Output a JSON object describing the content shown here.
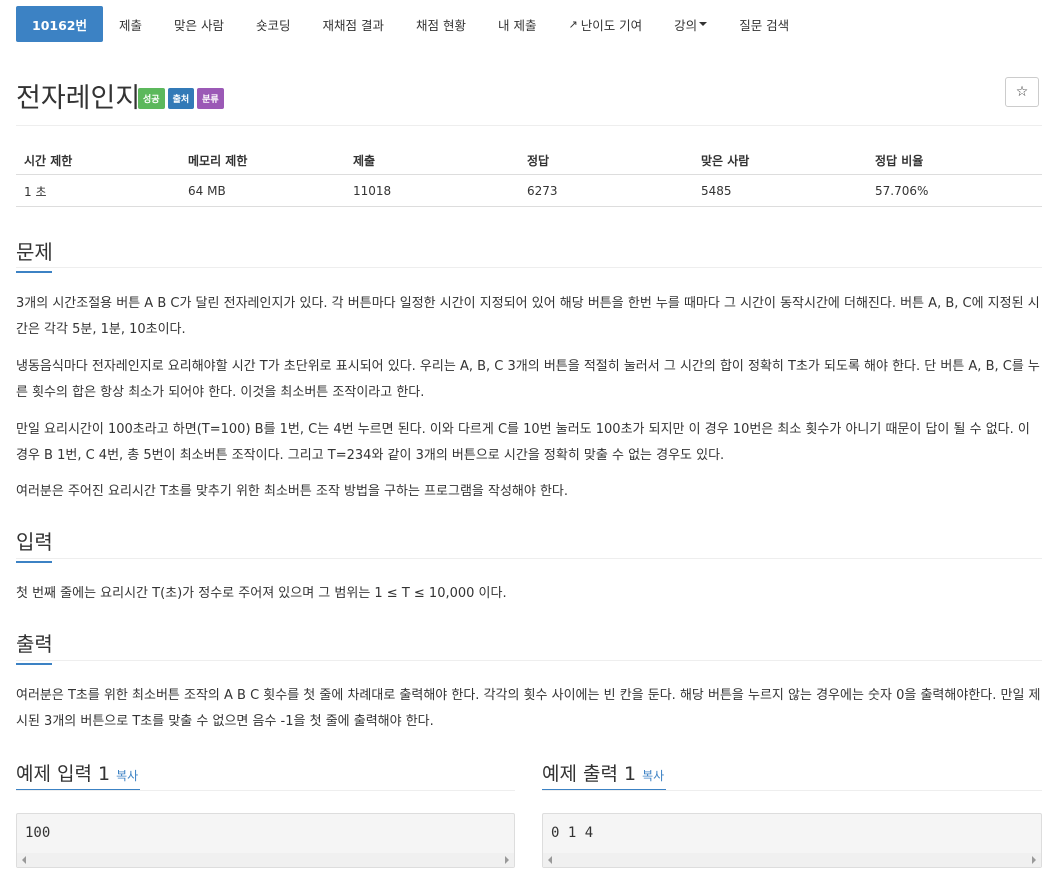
{
  "nav": {
    "tabs": [
      {
        "label": "10162번"
      },
      {
        "label": "제출"
      },
      {
        "label": "맞은 사람"
      },
      {
        "label": "숏코딩"
      },
      {
        "label": "재채점 결과"
      },
      {
        "label": "채점 현황"
      },
      {
        "label": "내 제출"
      },
      {
        "label": "난이도 기여"
      },
      {
        "label": "강의"
      },
      {
        "label": "질문 검색"
      }
    ],
    "active_tab": "10162번"
  },
  "problem": {
    "title": "전자레인지",
    "labels": [
      {
        "text": "성공",
        "color": "#5cb85c"
      },
      {
        "text": "출처",
        "color": "#337ab7"
      },
      {
        "text": "분류",
        "color": "#9b59b6"
      }
    ],
    "star_icon": "star-icon"
  },
  "info_table": {
    "headers": [
      "시간 제한",
      "메모리 제한",
      "제출",
      "정답",
      "맞은 사람",
      "정답 비율"
    ],
    "values": [
      "1 초",
      "64 MB",
      "11018",
      "6273",
      "5485",
      "57.706%"
    ]
  },
  "sections": {
    "problem_heading": "문제",
    "problem_paragraphs": [
      "3개의 시간조절용 버튼 A B C가 달린 전자레인지가 있다. 각 버튼마다 일정한 시간이 지정되어 있어 해당 버튼을 한번 누를 때마다 그 시간이 동작시간에 더해진다. 버튼 A, B, C에 지정된 시간은 각각 5분, 1분, 10초이다.",
      "냉동음식마다 전자레인지로 요리해야할 시간 T가 초단위로 표시되어 있다. 우리는 A, B, C 3개의 버튼을 적절히 눌러서 그 시간의 합이 정확히 T초가 되도록 해야 한다. 단 버튼 A, B, C를 누른 횟수의 합은 항상 최소가 되어야 한다. 이것을 최소버튼 조작이라고 한다.",
      "만일 요리시간이 100초라고 하면(T=100) B를 1번, C는 4번 누르면 된다. 이와 다르게 C를 10번 눌러도 100초가 되지만 이 경우 10번은 최소 횟수가 아니기 때문이 답이 될 수 없다. 이 경우 B 1번, C 4번, 총 5번이 최소버튼 조작이다. 그리고 T=234와 같이 3개의 버튼으로 시간을 정확히 맞출 수 없는 경우도 있다.",
      "여러분은 주어진 요리시간 T초를 맞추기 위한 최소버튼 조작 방법을 구하는 프로그램을 작성해야 한다."
    ],
    "input_heading": "입력",
    "input_text": "첫 번째 줄에는 요리시간 T(초)가 정수로 주어져 있으며 그 범위는 1 ≤ T ≤ 10,000 이다.",
    "output_heading": "출력",
    "output_text": "여러분은 T초를 위한 최소버튼 조작의 A B C 횟수를 첫 줄에 차례대로 출력해야 한다. 각각의 횟수 사이에는 빈 칸을 둔다. 해당 버튼을 누르지 않는 경우에는 숫자 0을 출력해야한다. 만일 제시된 3개의 버튼으로 T초를 맞출 수 없으면 음수 -1을 첫 줄에 출력해야 한다."
  },
  "samples": {
    "input_title": "예제 입력 1",
    "output_title": "예제 출력 1",
    "copy_label": "복사",
    "input_value": "100",
    "output_value": "0 1 4"
  }
}
